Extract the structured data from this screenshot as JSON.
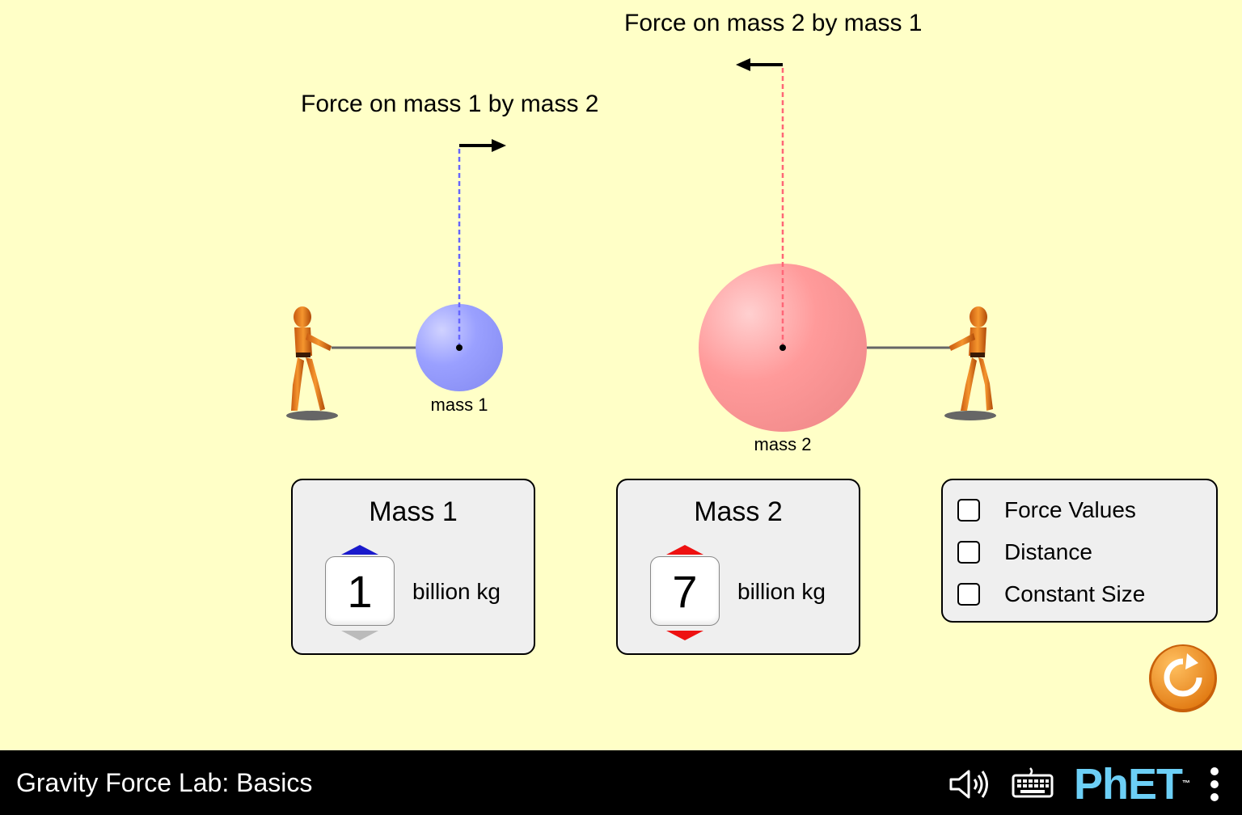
{
  "scene": {
    "force_label_1": "Force on mass 1 by mass 2",
    "force_label_2": "Force on mass 2 by mass 1",
    "mass_1_label": "mass 1",
    "mass_2_label": "mass 2",
    "colors": {
      "mass_1": "#9aa0ff",
      "mass_2": "#ff9a9a",
      "dashed_1": "#6666ff",
      "dashed_2": "#ff6677",
      "background": "#ffffc7"
    },
    "icons": [
      "puller-figure",
      "force-arrow-right",
      "force-arrow-left"
    ]
  },
  "mass1_panel": {
    "title": "Mass 1",
    "value": "1",
    "unit": "billion kg",
    "accent": "#1a1acc"
  },
  "mass2_panel": {
    "title": "Mass 2",
    "value": "7",
    "unit": "billion kg",
    "accent": "#ee1111"
  },
  "options_panel": {
    "items": [
      {
        "label": "Force Values",
        "checked": false
      },
      {
        "label": "Distance",
        "checked": false
      },
      {
        "label": "Constant Size",
        "checked": false
      }
    ]
  },
  "reset": {
    "icon": "reset-icon",
    "color": "#f08a1c"
  },
  "navbar": {
    "title": "Gravity Force Lab: Basics",
    "icons": [
      "sound-icon",
      "keyboard-icon",
      "phet-menu-icon"
    ],
    "logo": "PhET"
  }
}
